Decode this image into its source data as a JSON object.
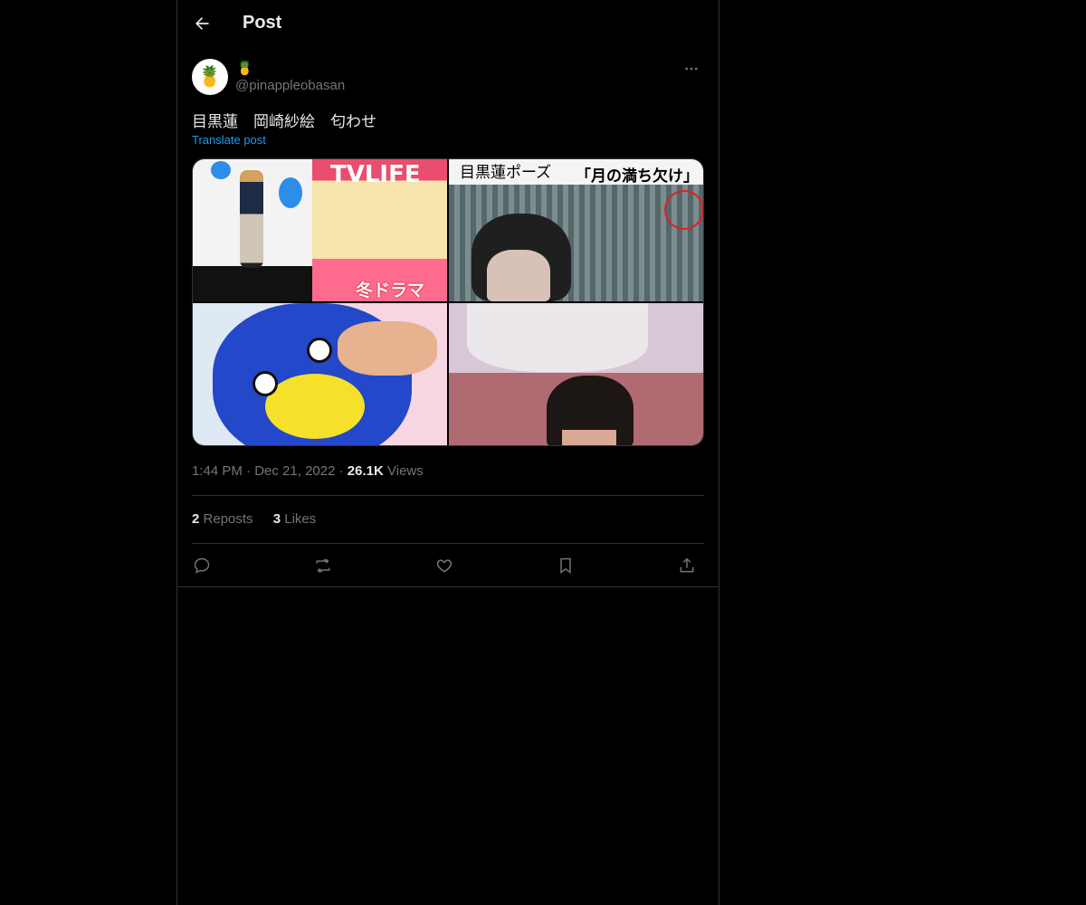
{
  "header": {
    "title": "Post"
  },
  "author": {
    "display_name": "🍍",
    "handle": "@pinappleobasan",
    "avatar_glyph": "🍍"
  },
  "tweet": {
    "text": "目黒蓮　岡崎紗絵　匂わせ",
    "translate_label": "Translate post"
  },
  "media": {
    "images": [
      {
        "alt": "image-1",
        "caption": "TVLIFE",
        "caption2": "冬ドラマ"
      },
      {
        "alt": "image-2",
        "caption": "目黒蓮ポーズ",
        "caption2": "「月の満ち欠け」"
      },
      {
        "alt": "image-3"
      },
      {
        "alt": "image-4"
      }
    ]
  },
  "meta": {
    "time": "1:44 PM",
    "separator": "·",
    "date": "Dec 21, 2022",
    "views_count": "26.1K",
    "views_label": "Views"
  },
  "stats": {
    "reposts_count": "2",
    "reposts_label": "Reposts",
    "likes_count": "3",
    "likes_label": "Likes"
  },
  "colors": {
    "background": "#000000",
    "text": "#e7e9ea",
    "muted": "#71767b",
    "accent": "#1d9bf0",
    "border": "#2f3336"
  },
  "icons": [
    "back-arrow-icon",
    "more-icon",
    "reply-icon",
    "repost-icon",
    "like-icon",
    "bookmark-icon",
    "share-icon"
  ]
}
